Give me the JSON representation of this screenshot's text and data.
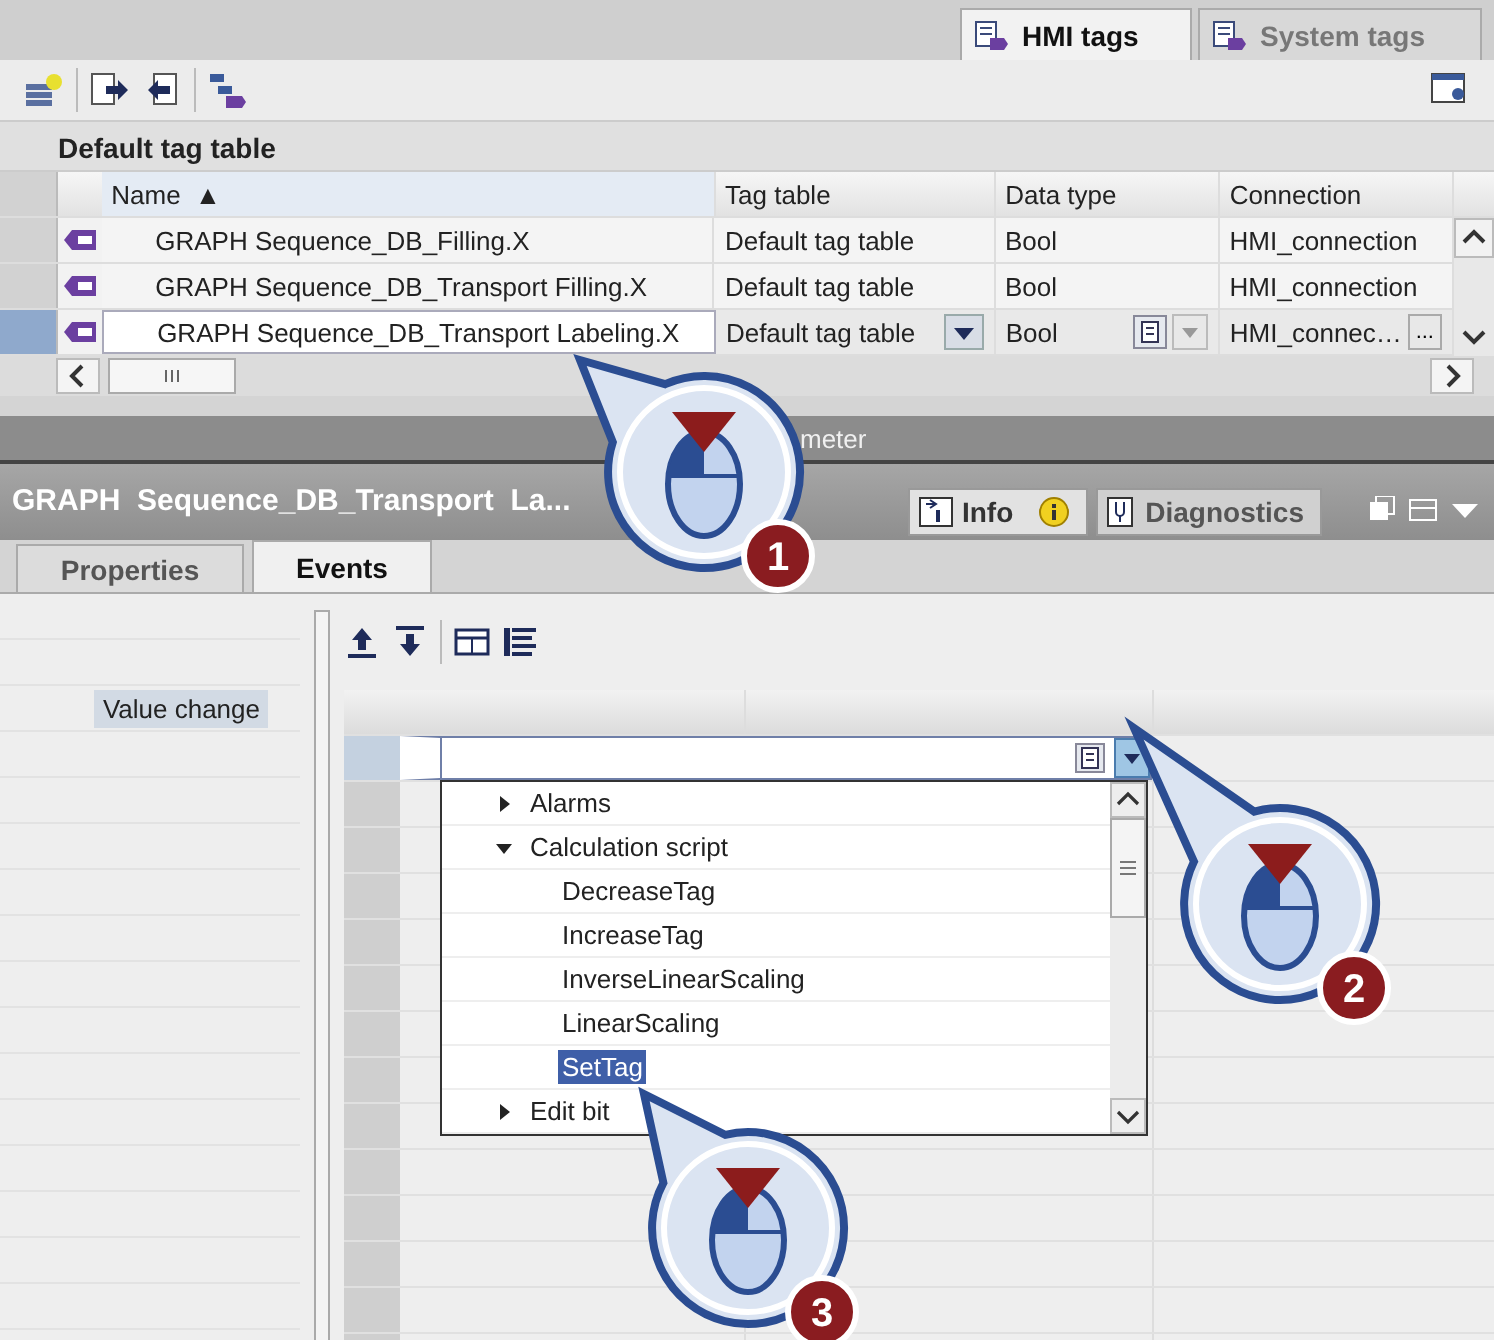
{
  "top_tabs": [
    {
      "label": "HMI tags",
      "selected": true
    },
    {
      "label": "System tags",
      "selected": false
    }
  ],
  "tag_table": {
    "title": "Default tag table",
    "columns": [
      {
        "label": "Name",
        "sort_mark": "▲"
      },
      {
        "label": "Tag table"
      },
      {
        "label": "Data type"
      },
      {
        "label": "Connection"
      }
    ],
    "rows": [
      {
        "name": "GRAPH Sequence_DB_Filling.X",
        "tag_table": "Default tag table",
        "data_type": "Bool",
        "connection": "HMI_connection",
        "editing": false
      },
      {
        "name": "GRAPH Sequence_DB_Transport Filling.X",
        "tag_table": "Default tag table",
        "data_type": "Bool",
        "connection": "HMI_connection",
        "editing": false
      },
      {
        "name": "GRAPH Sequence_DB_Transport Labeling.X",
        "tag_table": "Default tag table",
        "data_type": "Bool",
        "connection": "HMI_connec…",
        "editing": true,
        "browse_button": "..."
      }
    ]
  },
  "strip_text": "meter",
  "panel": {
    "title": "GRAPH  Sequence_DB_Transport  La...",
    "side_tabs": [
      {
        "label": "Info",
        "selected": true
      },
      {
        "label": "Diagnostics",
        "selected": false
      }
    ]
  },
  "inspector_tabs": [
    {
      "label": "Properties",
      "selected": false
    },
    {
      "label": "Events",
      "selected": true
    }
  ],
  "events": [
    {
      "label": "Value change",
      "selected": true
    }
  ],
  "function_list": [
    {
      "label": "Alarms",
      "expanded": false,
      "selected": false
    },
    {
      "label": "Calculation script",
      "expanded": true,
      "selected": false,
      "children": [
        {
          "label": "DecreaseTag",
          "selected": false
        },
        {
          "label": "IncreaseTag",
          "selected": false
        },
        {
          "label": "InverseLinearScaling",
          "selected": false
        },
        {
          "label": "LinearScaling",
          "selected": false
        },
        {
          "label": "SetTag",
          "selected": true
        }
      ]
    },
    {
      "label": "Edit bit",
      "expanded": false,
      "selected": false
    }
  ],
  "callouts": [
    {
      "number": "1"
    },
    {
      "number": "2"
    },
    {
      "number": "3"
    }
  ]
}
